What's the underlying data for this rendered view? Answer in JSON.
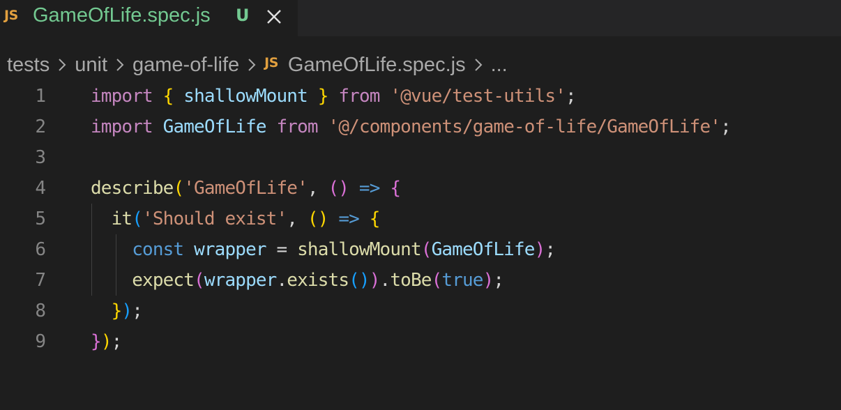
{
  "tab": {
    "icon": "JS",
    "title": "GameOfLife.spec.js",
    "status": "U"
  },
  "breadcrumb": {
    "items": [
      "tests",
      "unit",
      "game-of-life"
    ],
    "file_icon": "JS",
    "file": "GameOfLife.spec.js",
    "more": "..."
  },
  "editor": {
    "line_numbers": [
      "1",
      "2",
      "3",
      "4",
      "5",
      "6",
      "7",
      "8",
      "9"
    ],
    "tokens": {
      "import": "import",
      "from": "from",
      "shallowMount": "shallowMount",
      "gameOfLife": "GameOfLife",
      "testUtils": "'@vue/test-utils'",
      "componentPath": "'@/components/game-of-life/GameOfLife'",
      "describe": "describe",
      "describeName": "'GameOfLife'",
      "it": "it",
      "itName": "'Should exist'",
      "const": "const",
      "wrapper": "wrapper",
      "expect": "expect",
      "exists": "exists",
      "toBe": "toBe",
      "true": "true"
    }
  },
  "colors": {
    "background": "#1e1e1e",
    "tab_modified": "#73c991",
    "js_icon": "#e2a03f"
  }
}
